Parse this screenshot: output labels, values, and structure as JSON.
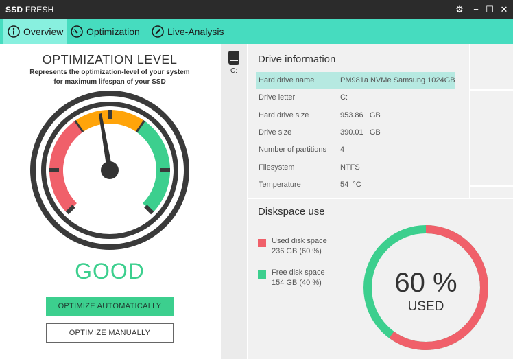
{
  "app": {
    "title_bold": "SSD",
    "title_rest": " FRESH"
  },
  "window_controls": {
    "settings": "⚙",
    "minimize": "−",
    "maximize": "☐",
    "close": "✕"
  },
  "tabs": [
    {
      "label": "Overview",
      "active": true,
      "icon": "info-icon"
    },
    {
      "label": "Optimization",
      "active": false,
      "icon": "speedometer-icon"
    },
    {
      "label": "Live-Analysis",
      "active": false,
      "icon": "pen-icon"
    }
  ],
  "optimization": {
    "title": "OPTIMIZATION LEVEL",
    "subtitle": "Represents the optimization-level of your system for maximum lifespan of your SSD",
    "level": "GOOD",
    "gauge_colors": {
      "red": "#f0606a",
      "orange": "#ffa40a",
      "green": "#3ccf8e",
      "ring": "#3a3a3a",
      "needle": "#333333"
    },
    "auto_button": "OPTIMIZE AUTOMATICALLY",
    "manual_button": "OPTIMIZE MANUALLY"
  },
  "drives": [
    {
      "letter": "C:",
      "icon": "drive-icon"
    }
  ],
  "drive_info": {
    "title": "Drive information",
    "rows": [
      {
        "key": "Hard drive name",
        "value": "PM981a NVMe Samsung 1024GB"
      },
      {
        "key": "Drive letter",
        "value": "C:"
      },
      {
        "key": "Hard drive size",
        "value": "953.86   GB"
      },
      {
        "key": "Drive size",
        "value": "390.01   GB"
      },
      {
        "key": "Number of partitions",
        "value": "4"
      },
      {
        "key": "Filesystem",
        "value": "NTFS"
      },
      {
        "key": "Temperature",
        "value": "54  °C"
      }
    ]
  },
  "diskspace": {
    "title": "Diskspace use",
    "used": {
      "label": "Used disk space",
      "value": "236 GB (60 %)",
      "color": "#f0606a"
    },
    "free": {
      "label": "Free disk space",
      "value": "154 GB (40 %)",
      "color": "#3ccf8e"
    },
    "used_fraction": 0.6,
    "percent_text": "60 %",
    "used_text": "USED"
  },
  "colors": {
    "accent": "#46dcbf",
    "active_tab": "#88f0df",
    "titlebar": "#2b2b2b",
    "highlight_row": "#b6e9e1"
  }
}
